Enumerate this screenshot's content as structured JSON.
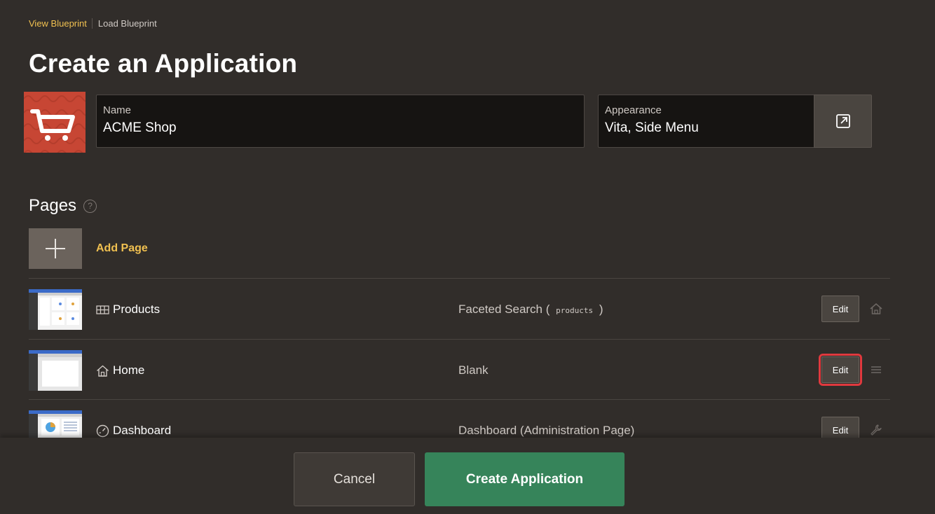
{
  "breadcrumb": {
    "view_blueprint": "View Blueprint",
    "load_blueprint": "Load Blueprint"
  },
  "page_title": "Create an Application",
  "icon": {
    "name": "cart-icon",
    "bg_color": "#c74634"
  },
  "name_field": {
    "label": "Name",
    "value": "ACME Shop"
  },
  "appearance_field": {
    "label": "Appearance",
    "value": "Vita, Side Menu"
  },
  "pages": {
    "title": "Pages",
    "help": "?",
    "add_label": "Add Page",
    "rows": [
      {
        "name": "Products",
        "icon": "grid-icon",
        "type": "Faceted Search (",
        "source": "products",
        "type_end": ")",
        "edit": "Edit",
        "action_icon": "home-icon"
      },
      {
        "name": "Home",
        "icon": "home-icon",
        "type": "Blank",
        "edit": "Edit",
        "action_icon": "drag-handle-icon"
      },
      {
        "name": "Dashboard",
        "icon": "gauge-icon",
        "type": "Dashboard (Administration Page)",
        "edit": "Edit",
        "action_icon": "wrench-icon"
      }
    ]
  },
  "footer": {
    "cancel": "Cancel",
    "create": "Create Application"
  },
  "colors": {
    "accent": "#f0c050",
    "primary": "#36845a",
    "highlight": "#e0393e",
    "background": "#312d2a"
  }
}
